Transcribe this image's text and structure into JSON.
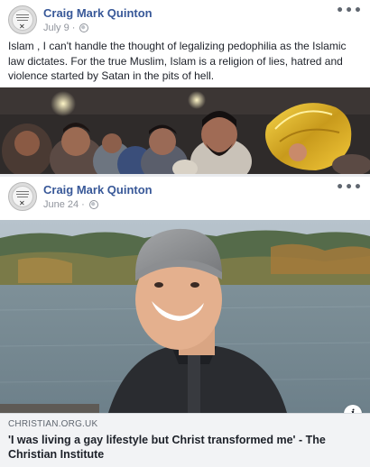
{
  "posts": [
    {
      "author": "Craig Mark Quinton",
      "date": "July 9",
      "separator": "·",
      "privacy_icon": "globe-icon",
      "more_icon": "more-options-icon",
      "text": "Islam , I can't handle the thought of legalizing pedophilia as the Islamic law dictates. For the true Muslim, Islam is a religion of lies, hatred and violence started by Satan in the pits of hell."
    },
    {
      "author": "Craig Mark Quinton",
      "date": "June 24",
      "separator": "·",
      "privacy_icon": "globe-icon",
      "more_icon": "more-options-icon",
      "link": {
        "domain": "CHRISTIAN.ORG.UK",
        "title": "'I was living a gay lifestyle but Christ transformed me' - The Christian Institute",
        "info_icon": "info-icon"
      }
    }
  ],
  "colors": {
    "author_link": "#385898",
    "meta_gray": "#90949c",
    "feed_background": "#e9ebee",
    "link_box": "#f2f3f5"
  }
}
